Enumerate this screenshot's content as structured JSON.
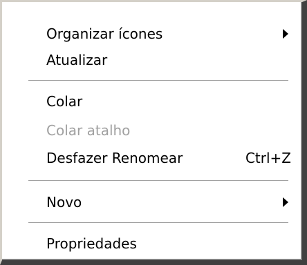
{
  "menu": {
    "items": [
      {
        "label": "Organizar ícones",
        "submenu": true,
        "enabled": true
      },
      {
        "label": "Atualizar",
        "submenu": false,
        "enabled": true
      },
      {
        "label": "Colar",
        "submenu": false,
        "enabled": true
      },
      {
        "label": "Colar atalho",
        "submenu": false,
        "enabled": false
      },
      {
        "label": "Desfazer Renomear",
        "shortcut": "Ctrl+Z",
        "submenu": false,
        "enabled": true
      },
      {
        "label": "Novo",
        "submenu": true,
        "enabled": true
      },
      {
        "label": "Propriedades",
        "submenu": false,
        "enabled": true
      }
    ]
  },
  "colors": {
    "background": "#ffffff",
    "text": "#000000",
    "disabled_text": "#a0a0a0",
    "separator": "#a0a0a0"
  }
}
